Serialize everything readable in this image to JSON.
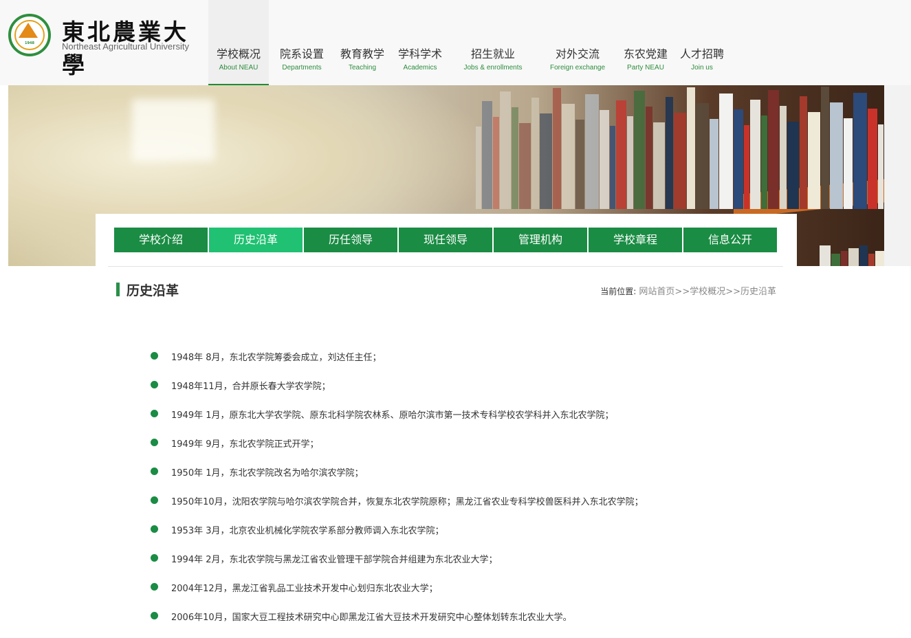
{
  "header": {
    "logo_cn": "東北農業大學",
    "logo_en": "Northeast Agricultural University",
    "emblem_year": "1948"
  },
  "nav": [
    {
      "cn": "学校概况",
      "en": "About NEAU",
      "active": true
    },
    {
      "cn": "院系设置",
      "en": "Departments"
    },
    {
      "cn": "教育教学",
      "en": "Teaching"
    },
    {
      "cn": "学科学术",
      "en": "Academics"
    },
    {
      "cn": "招生就业",
      "en": "Jobs & enrollments"
    },
    {
      "cn": "对外交流",
      "en": "Foreign exchange"
    },
    {
      "cn": "东农党建",
      "en": "Party NEAU"
    },
    {
      "cn": "人才招聘",
      "en": "Join us"
    }
  ],
  "subnav": [
    {
      "label": "学校介绍"
    },
    {
      "label": "历史沿革",
      "active": true
    },
    {
      "label": "历任领导"
    },
    {
      "label": "现任领导"
    },
    {
      "label": "管理机构"
    },
    {
      "label": "学校章程"
    },
    {
      "label": "信息公开"
    }
  ],
  "content": {
    "title": "历史沿革",
    "breadcrumb_label": "当前位置:",
    "breadcrumb": "网站首页>>学校概况>>历史沿革"
  },
  "timeline": [
    "1948年 8月，东北农学院筹委会成立，刘达任主任；",
    "1948年11月，合并原长春大学农学院；",
    "1949年 1月，原东北大学农学院、原东北科学院农林系、原哈尔滨市第一技术专科学校农学科并入东北农学院；",
    "1949年 9月，东北农学院正式开学；",
    "1950年 1月，东北农学院改名为哈尔滨农学院；",
    "1950年10月，沈阳农学院与哈尔滨农学院合并，恢复东北农学院原称；黑龙江省农业专科学校兽医科并入东北农学院；",
    "1953年 3月，北京农业机械化学院农学系部分教师调入东北农学院；",
    "1994年 2月，东北农学院与黑龙江省农业管理干部学院合并组建为东北农业大学；",
    "2004年12月，黑龙江省乳品工业技术开发中心划归东北农业大学；",
    "2006年10月，国家大豆工程技术研究中心即黑龙江省大豆技术开发研究中心整体划转东北农业大学。"
  ],
  "colors": {
    "green": "#1a8c44",
    "active_tab": "#20c172",
    "nav_en": "#2c8c3c"
  }
}
